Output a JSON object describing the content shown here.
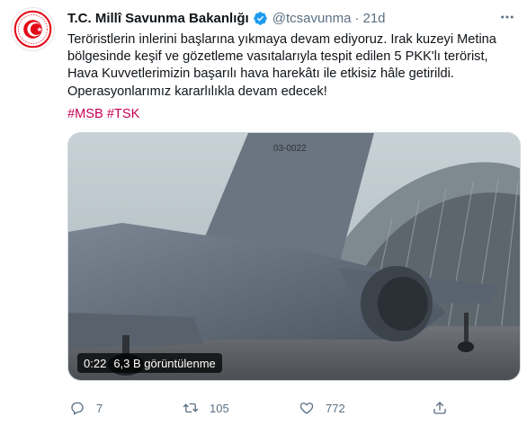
{
  "tweet": {
    "author": {
      "display_name": "T.C. Millî Savunma Bakanlığı",
      "verified_icon": "verified-badge-icon",
      "handle": "@tcsavunma",
      "separator": "·",
      "time": "21d"
    },
    "text_lines": [
      "Teröristlerin inlerini başlarına yıkmaya devam ediyoruz. Irak kuzeyi Metina",
      "bölgesinde keşif ve gözetleme vasıtalarıyla tespit edilen 5 PKK'lı terörist,",
      "Hava Kuvvetlerimizin başarılı hava harekâtı ile etkisiz hâle getirildi.",
      "Operasyonlarımız kararlılıkla devam edecek!"
    ],
    "hashtags": [
      "#MSB",
      "#TSK"
    ],
    "media": {
      "duration": "0:22",
      "views": "6,3 B görüntülenme",
      "tail_code": "03-0022"
    },
    "actions": {
      "reply_count": "7",
      "retweet_count": "105",
      "like_count": "772"
    }
  },
  "colors": {
    "text": "#0f1419",
    "secondary": "#5b7083",
    "hashtag": "#c70055",
    "verified": "#1d9bf0",
    "logo_red": "#e30a17"
  },
  "icons": [
    "logo-avatar",
    "verified-badge-icon",
    "more-icon",
    "reply-icon",
    "retweet-icon",
    "like-icon",
    "share-icon"
  ]
}
